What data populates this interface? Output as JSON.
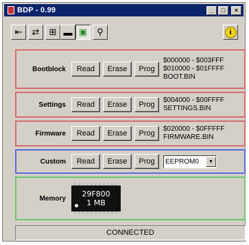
{
  "window": {
    "title": "BDP - 0.99"
  },
  "toolbar": {
    "tools": [
      {
        "name": "exit-door-icon",
        "glyph": "⇤"
      },
      {
        "name": "open-file-icon",
        "glyph": "⇄"
      },
      {
        "name": "network-icon",
        "glyph": "⊞"
      },
      {
        "name": "chip-icon",
        "glyph": "▬"
      },
      {
        "name": "memory-board-icon",
        "glyph": "▣"
      },
      {
        "name": "zoom-icon",
        "glyph": "⚲"
      },
      {
        "name": "info-icon",
        "glyph": "i"
      }
    ]
  },
  "buttons": {
    "read": "Read",
    "erase": "Erase",
    "prog": "Prog"
  },
  "groups": {
    "bootblock": {
      "label": "Bootblock",
      "line1": "$000000 - $003FFF",
      "line2": "$010000 - $01FFFF",
      "line3": "BOOT.BIN"
    },
    "settings": {
      "label": "Settings",
      "line1": "$004000 - $00FFFF",
      "line2": "SETTINGS.BIN"
    },
    "firmware": {
      "label": "Firmware",
      "line1": "$020000 - $0FFFFF",
      "line2": "FIRMWARE.BIN"
    },
    "custom": {
      "label": "Custom",
      "select_value": "EEPROM0"
    },
    "memory": {
      "label": "Memory",
      "chip_line1": "29F800",
      "chip_line2": "1 MB"
    }
  },
  "status": {
    "text": "CONNECTED"
  },
  "colors": {
    "title_bg": "#0a246a",
    "red_frame": "#d86c6c",
    "blue_frame": "#5c6cd8",
    "green_frame": "#6cc86c"
  }
}
